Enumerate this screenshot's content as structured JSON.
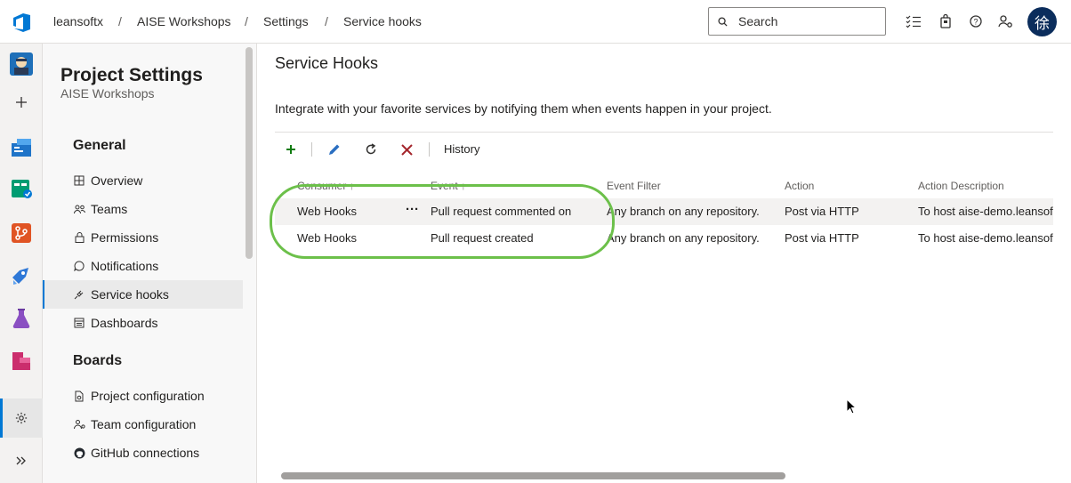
{
  "breadcrumb": {
    "org": "leansoftx",
    "project": "AISE Workshops",
    "settings": "Settings",
    "current": "Service hooks",
    "separator": "/"
  },
  "search": {
    "placeholder": "Search"
  },
  "user": {
    "avatar_text": "徐"
  },
  "colors": {
    "accent": "#0078d4",
    "highlight_ring": "#6cc04a",
    "delete_icon": "#a4262c",
    "add_icon": "#107c10"
  },
  "nav": {
    "title": "Project Settings",
    "subtitle": "AISE Workshops",
    "sections": [
      {
        "heading": "General",
        "items": [
          {
            "label": "Overview",
            "icon": "overview-icon"
          },
          {
            "label": "Teams",
            "icon": "teams-icon"
          },
          {
            "label": "Permissions",
            "icon": "lock-icon"
          },
          {
            "label": "Notifications",
            "icon": "chat-bubble-icon"
          },
          {
            "label": "Service hooks",
            "icon": "plug-icon",
            "active": true
          },
          {
            "label": "Dashboards",
            "icon": "dashboard-icon"
          }
        ]
      },
      {
        "heading": "Boards",
        "items": [
          {
            "label": "Project configuration",
            "icon": "doc-gear-icon"
          },
          {
            "label": "Team configuration",
            "icon": "team-gear-icon"
          },
          {
            "label": "GitHub connections",
            "icon": "github-icon"
          }
        ]
      }
    ]
  },
  "main": {
    "title": "Service Hooks",
    "description": "Integrate with your favorite services by notifying them when events happen in your project.",
    "toolbar": {
      "history_label": "History"
    },
    "columns": [
      "Consumer",
      "Event",
      "Event Filter",
      "Action",
      "Action Description"
    ],
    "rows": [
      {
        "consumer": "Web Hooks",
        "event": "Pull request commented on",
        "filter": "Any branch on any repository.",
        "action": "Post via HTTP",
        "description": "To host aise-demo.leansoftx.com",
        "selected": true
      },
      {
        "consumer": "Web Hooks",
        "event": "Pull request created",
        "filter": "Any branch on any repository.",
        "action": "Post via HTTP",
        "description": "To host aise-demo.leansoftx.com"
      }
    ]
  }
}
